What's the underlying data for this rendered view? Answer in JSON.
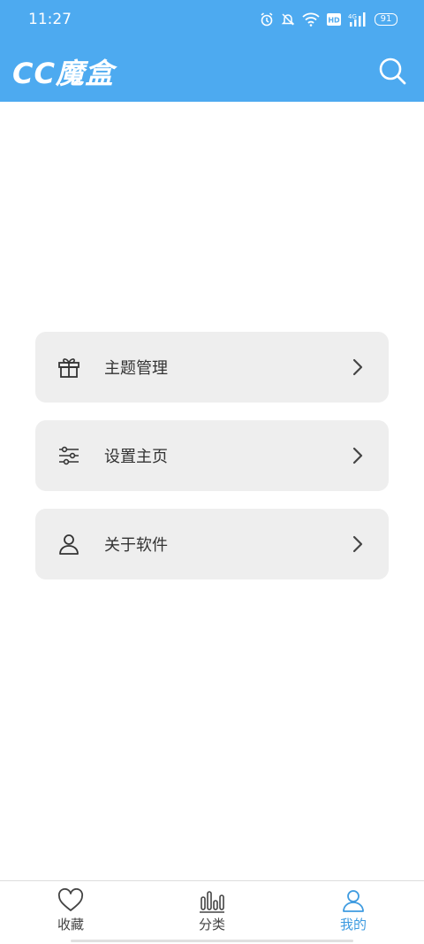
{
  "status_bar": {
    "time": "11:27",
    "battery": "91"
  },
  "header": {
    "title": "CC魔盒",
    "search_icon": "search-icon"
  },
  "menu": [
    {
      "label": "主题管理",
      "icon": "gift-icon"
    },
    {
      "label": "设置主页",
      "icon": "sliders-icon"
    },
    {
      "label": "关于软件",
      "icon": "user-icon"
    }
  ],
  "bottom_nav": [
    {
      "label": "收藏",
      "icon": "heart-icon",
      "active": false
    },
    {
      "label": "分类",
      "icon": "bar-chart-icon",
      "active": false
    },
    {
      "label": "我的",
      "icon": "user-icon",
      "active": true
    }
  ],
  "colors": {
    "header": "#4DAAF0",
    "active_tab": "#3E9BE0",
    "card": "#EEEEEE"
  }
}
